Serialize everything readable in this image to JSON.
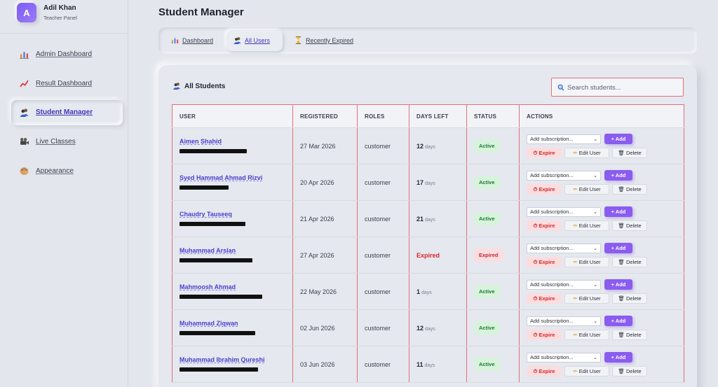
{
  "profile": {
    "initial": "A",
    "name": "Adil Khan",
    "role": "Teacher Panel"
  },
  "sidebar": {
    "items": [
      {
        "label": "Admin Dashboard",
        "icon": "bar-chart-icon",
        "active": false
      },
      {
        "label": "Result Dashboard",
        "icon": "trend-line-icon",
        "active": false
      },
      {
        "label": "Student Manager",
        "icon": "users-icon",
        "active": true
      },
      {
        "label": "Live Classes",
        "icon": "video-camera-icon",
        "active": false
      },
      {
        "label": "Appearance",
        "icon": "palette-icon",
        "active": false
      }
    ]
  },
  "page": {
    "title": "Student Manager"
  },
  "tabs": [
    {
      "label": "Dashboard",
      "icon": "bar-chart-icon",
      "active": false
    },
    {
      "label": "All Users",
      "icon": "users-icon",
      "active": true
    },
    {
      "label": "Recently Expired",
      "icon": "hourglass-icon",
      "active": false
    }
  ],
  "card": {
    "title": "All Students",
    "icon": "users-icon"
  },
  "search": {
    "placeholder": "Search students...",
    "value": ""
  },
  "table": {
    "headers": [
      "USER",
      "REGISTERED",
      "ROLES",
      "DAYS LEFT",
      "STATUS",
      "ACTIONS"
    ],
    "rows": [
      {
        "name": "Aimen Shahid",
        "registered": "27 Mar 2026",
        "role": "customer",
        "days": "12",
        "days_unit": "days",
        "expired": false,
        "status": "Active"
      },
      {
        "name": "Syed Hammad Ahmad Rizvi",
        "registered": "20 Apr 2026",
        "role": "customer",
        "days": "17",
        "days_unit": "days",
        "expired": false,
        "status": "Active"
      },
      {
        "name": "Chaudry Tauseeq",
        "registered": "21 Apr 2026",
        "role": "customer",
        "days": "21",
        "days_unit": "days",
        "expired": false,
        "status": "Active"
      },
      {
        "name": "Muhammad Arslan",
        "registered": "27 Apr 2026",
        "role": "customer",
        "days": "Expired",
        "days_unit": "",
        "expired": true,
        "status": "Expired"
      },
      {
        "name": "Mahmoosh Ahmad",
        "registered": "22 May 2026",
        "role": "customer",
        "days": "1",
        "days_unit": "days",
        "expired": false,
        "status": "Active"
      },
      {
        "name": "Muhammad Ziqwan",
        "registered": "02 Jun 2026",
        "role": "customer",
        "days": "12",
        "days_unit": "days",
        "expired": false,
        "status": "Active"
      },
      {
        "name": "Muhammad Ibrahim Qureshi",
        "registered": "03 Jun 2026",
        "role": "customer",
        "days": "11",
        "days_unit": "days",
        "expired": false,
        "status": "Active"
      }
    ]
  },
  "actions": {
    "select_value": "Add subscription...",
    "add_label": "+ Add",
    "expire_label": "Expire",
    "edit_label": "Edit User",
    "delete_label": "Delete"
  },
  "colors": {
    "accent": "#8a5cf0",
    "link": "#4a3fd0",
    "danger": "#d62828",
    "success": "#1e7a35",
    "background": "#e3e6ec"
  }
}
